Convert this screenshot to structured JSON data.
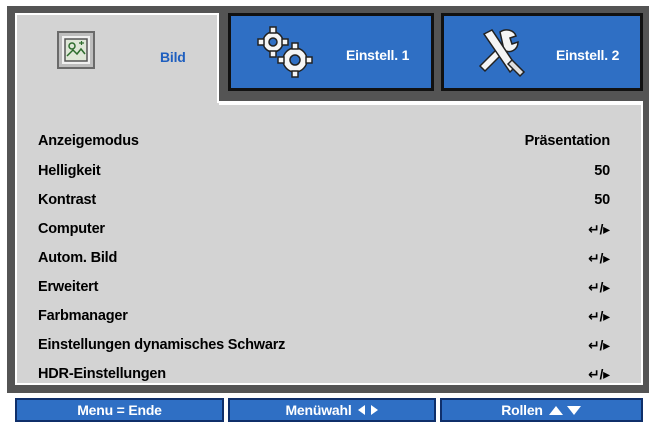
{
  "tabs": [
    {
      "label": "Bild",
      "icon": "picture-settings-icon",
      "active": true
    },
    {
      "label": "Einstell. 1",
      "icon": "gears-icon",
      "active": false
    },
    {
      "label": "Einstell. 2",
      "icon": "tools-icon",
      "active": false
    }
  ],
  "menu": {
    "items": [
      {
        "label": "Anzeigemodus",
        "value": "Präsentation"
      },
      {
        "label": "Helligkeit",
        "value": "50"
      },
      {
        "label": "Kontrast",
        "value": "50"
      },
      {
        "label": "Computer",
        "value": "↵/▸"
      },
      {
        "label": "Autom. Bild",
        "value": "↵/▸"
      },
      {
        "label": "Erweitert",
        "value": "↵/▸"
      },
      {
        "label": "Farbmanager",
        "value": "↵/▸"
      },
      {
        "label": "Einstellungen dynamisches Schwarz",
        "value": "↵/▸"
      },
      {
        "label": "HDR-Einstellungen",
        "value": "↵/▸"
      }
    ]
  },
  "footer": {
    "menu_exit": "Menu = Ende",
    "menu_select": "Menüwahl",
    "scroll": "Rollen"
  },
  "colors": {
    "accent_blue": "#2f6fc4",
    "panel_gray": "#d3d3d3",
    "frame_gray": "#545454",
    "active_tab_text": "#1f5fbf"
  }
}
